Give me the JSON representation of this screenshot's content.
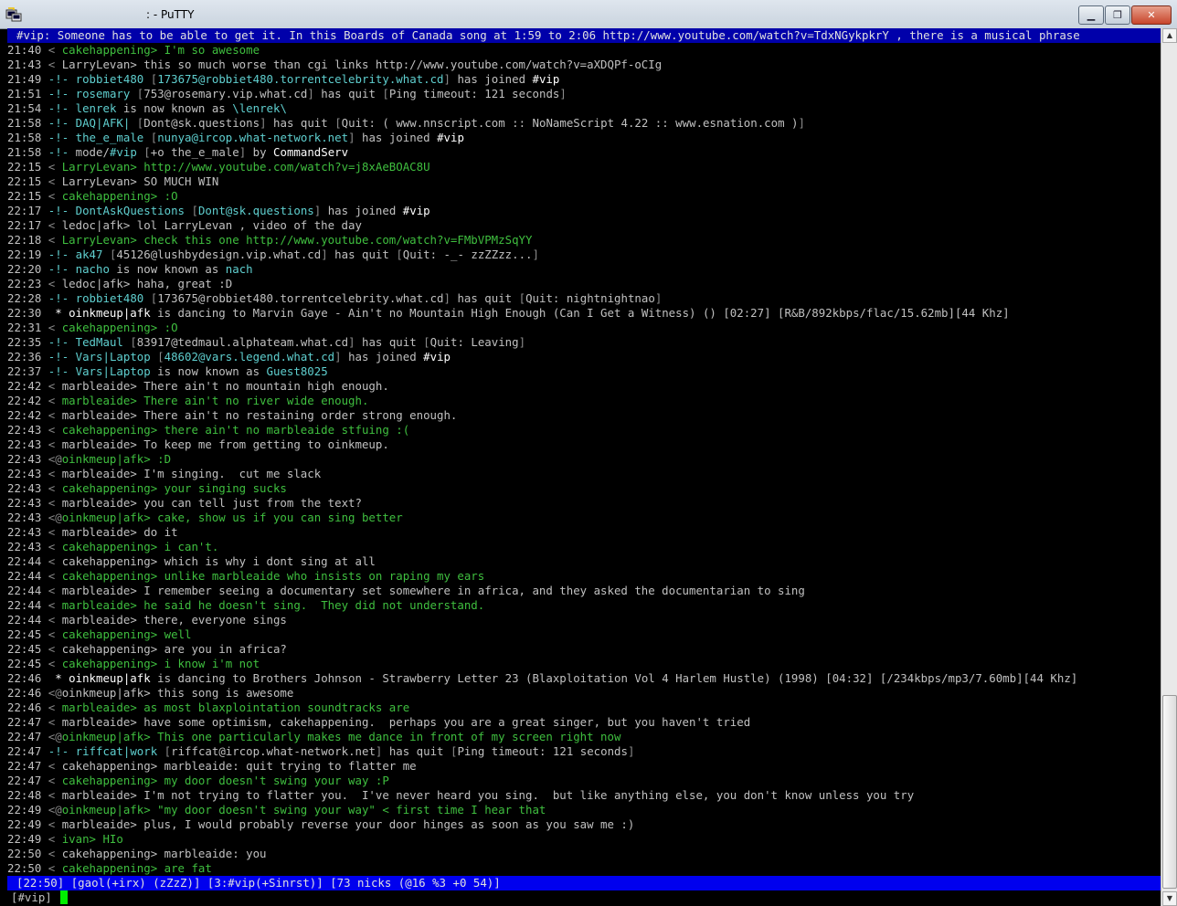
{
  "window": {
    "title": ": - PuTTY",
    "minimize_icon": "minimize-icon",
    "maximize_icon": "maximize-icon",
    "close_icon": "close-icon",
    "close_label": "✕",
    "minimize_label": "▁",
    "maximize_label": "❐"
  },
  "topic": "#vip: Someone has to be able to get it. In this Boards of Canada song at 1:59 to 2:06 http://www.youtube.com/watch?v=TdxNGykpkrY , there is a musical phrase",
  "lines": [
    {
      "time": "21:40",
      "kind": "msg",
      "nick": "cakehappening",
      "text": "I'm so awesome",
      "color": "g"
    },
    {
      "time": "21:43",
      "kind": "msg",
      "nick": "LarryLevan",
      "text": "this so much worse than cgi links http://www.youtube.com/watch?v=aXDQPf-oCIg",
      "color": "n"
    },
    {
      "time": "21:49",
      "kind": "join",
      "nick": "robbiet480",
      "host": "173675@robbiet480.torrentcelebrity.what.cd",
      "text": "has joined",
      "chan": "#vip"
    },
    {
      "time": "21:51",
      "kind": "quit",
      "nick": "rosemary",
      "host": "753@rosemary.vip.what.cd",
      "text": "has quit",
      "reason": "Ping timeout: 121 seconds"
    },
    {
      "time": "21:54",
      "kind": "nick",
      "nick": "lenrek",
      "text": "is now known as",
      "newnick": "\\lenrek\\"
    },
    {
      "time": "21:58",
      "kind": "quitraw",
      "nick": "DAQ|AFK|",
      "host": "Dont@sk.questions",
      "text": "has quit",
      "reason": "Quit: ( www.nnscript.com :: NoNameScript 4.22 :: www.esnation.com )"
    },
    {
      "time": "21:58",
      "kind": "join",
      "nick": "the_e_male",
      "host": "nunya@ircop.what-network.net",
      "text": "has joined",
      "chan": "#vip"
    },
    {
      "time": "21:58",
      "kind": "mode",
      "text": "mode/",
      "chan": "#vip",
      "modes": "+o the_e_male",
      "by": "by",
      "setter": "CommandServ"
    },
    {
      "time": "22:15",
      "kind": "msg",
      "nick": "LarryLevan",
      "text": "http://www.youtube.com/watch?v=j8xAeBOAC8U",
      "color": "g"
    },
    {
      "time": "22:15",
      "kind": "msg",
      "nick": "LarryLevan",
      "text": "SO MUCH WIN",
      "color": "n"
    },
    {
      "time": "22:15",
      "kind": "msg",
      "nick": "cakehappening",
      "text": ":O",
      "color": "g"
    },
    {
      "time": "22:17",
      "kind": "join",
      "nick": "DontAskQuestions",
      "host": "Dont@sk.questions",
      "text": "has joined",
      "chan": "#vip"
    },
    {
      "time": "22:17",
      "kind": "msg",
      "nick": "ledoc|afk",
      "text": "lol LarryLevan , video of the day",
      "color": "n"
    },
    {
      "time": "22:18",
      "kind": "msg",
      "nick": "LarryLevan",
      "text": "check this one http://www.youtube.com/watch?v=FMbVPMzSqYY",
      "color": "g"
    },
    {
      "time": "22:19",
      "kind": "quit",
      "nick": "ak47",
      "host": "45126@lushbydesign.vip.what.cd",
      "text": "has quit",
      "reason": "Quit: -_- zzZZzz..."
    },
    {
      "time": "22:20",
      "kind": "nick",
      "nick": "nacho",
      "text": "is now known as",
      "newnick": "nach"
    },
    {
      "time": "22:23",
      "kind": "msg",
      "nick": "ledoc|afk",
      "text": "haha, great :D",
      "color": "n"
    },
    {
      "time": "22:28",
      "kind": "quit",
      "nick": "robbiet480",
      "host": "173675@robbiet480.torrentcelebrity.what.cd",
      "text": "has quit",
      "reason": "Quit: nightnightnao"
    },
    {
      "time": "22:30",
      "kind": "action",
      "nick": "oinkmeup|afk",
      "text": "is dancing to Marvin Gaye - Ain't no Mountain High Enough (Can I Get a Witness) () [02:27] [R&B/892kbps/flac/15.62mb][44 Khz]"
    },
    {
      "time": "22:31",
      "kind": "msg",
      "nick": "cakehappening",
      "text": ":O",
      "color": "g"
    },
    {
      "time": "22:35",
      "kind": "quit",
      "nick": "TedMaul",
      "host": "83917@tedmaul.alphateam.what.cd",
      "text": "has quit",
      "reason": "Quit: Leaving"
    },
    {
      "time": "22:36",
      "kind": "join",
      "nick": "Vars|Laptop",
      "host": "48602@vars.legend.what.cd",
      "text": "has joined",
      "chan": "#vip"
    },
    {
      "time": "22:37",
      "kind": "nick",
      "nick": "Vars|Laptop",
      "text": "is now known as",
      "newnick": "Guest8025"
    },
    {
      "time": "22:42",
      "kind": "msg",
      "nick": "marbleaide",
      "text": "There ain't no mountain high enough.",
      "color": "n"
    },
    {
      "time": "22:42",
      "kind": "msg",
      "nick": "marbleaide",
      "text": "There ain't no river wide enough.",
      "color": "g"
    },
    {
      "time": "22:42",
      "kind": "msg",
      "nick": "marbleaide",
      "text": "There ain't no restaining order strong enough.",
      "color": "n"
    },
    {
      "time": "22:43",
      "kind": "msg",
      "nick": "cakehappening",
      "text": "there ain't no marbleaide stfuing :(",
      "color": "g"
    },
    {
      "time": "22:43",
      "kind": "msg",
      "nick": "marbleaide",
      "text": "To keep me from getting to oinkmeup.",
      "color": "n"
    },
    {
      "time": "22:43",
      "kind": "opmsg",
      "nick": "oinkmeup|afk",
      "text": ":D",
      "color": "g"
    },
    {
      "time": "22:43",
      "kind": "msg",
      "nick": "marbleaide",
      "text": "I'm singing.  cut me slack",
      "color": "n"
    },
    {
      "time": "22:43",
      "kind": "msg",
      "nick": "cakehappening",
      "text": "your singing sucks",
      "color": "g"
    },
    {
      "time": "22:43",
      "kind": "msg",
      "nick": "marbleaide",
      "text": "you can tell just from the text?",
      "color": "n"
    },
    {
      "time": "22:43",
      "kind": "opmsg",
      "nick": "oinkmeup|afk",
      "text": "cake, show us if you can sing better",
      "color": "g"
    },
    {
      "time": "22:43",
      "kind": "msg",
      "nick": "marbleaide",
      "text": "do it",
      "color": "n"
    },
    {
      "time": "22:43",
      "kind": "msg",
      "nick": "cakehappening",
      "text": "i can't.",
      "color": "g"
    },
    {
      "time": "22:44",
      "kind": "msg",
      "nick": "cakehappening",
      "text": "which is why i dont sing at all",
      "color": "n"
    },
    {
      "time": "22:44",
      "kind": "msg",
      "nick": "cakehappening",
      "text": "unlike marbleaide who insists on raping my ears",
      "color": "g"
    },
    {
      "time": "22:44",
      "kind": "msg",
      "nick": "marbleaide",
      "text": "I remember seeing a documentary set somewhere in africa, and they asked the documentarian to sing",
      "color": "n"
    },
    {
      "time": "22:44",
      "kind": "msg",
      "nick": "marbleaide",
      "text": "he said he doesn't sing.  They did not understand.",
      "color": "g"
    },
    {
      "time": "22:44",
      "kind": "msg",
      "nick": "marbleaide",
      "text": "there, everyone sings",
      "color": "n"
    },
    {
      "time": "22:45",
      "kind": "msg",
      "nick": "cakehappening",
      "text": "well",
      "color": "g"
    },
    {
      "time": "22:45",
      "kind": "msg",
      "nick": "cakehappening",
      "text": "are you in africa?",
      "color": "n"
    },
    {
      "time": "22:45",
      "kind": "msg",
      "nick": "cakehappening",
      "text": "i know i'm not",
      "color": "g"
    },
    {
      "time": "22:46",
      "kind": "action",
      "nick": "oinkmeup|afk",
      "text": "is dancing to Brothers Johnson - Strawberry Letter 23 (Blaxploitation Vol 4 Harlem Hustle) (1998) [04:32] [/234kbps/mp3/7.60mb][44 Khz]"
    },
    {
      "time": "22:46",
      "kind": "opmsg",
      "nick": "oinkmeup|afk",
      "text": "this song is awesome",
      "color": "n"
    },
    {
      "time": "22:46",
      "kind": "msg",
      "nick": "marbleaide",
      "text": "as most blaxplointation soundtracks are",
      "color": "g"
    },
    {
      "time": "22:47",
      "kind": "msg",
      "nick": "marbleaide",
      "text": "have some optimism, cakehappening.  perhaps you are a great singer, but you haven't tried",
      "color": "n"
    },
    {
      "time": "22:47",
      "kind": "opmsg",
      "nick": "oinkmeup|afk",
      "text": "This one particularly makes me dance in front of my screen right now",
      "color": "g"
    },
    {
      "time": "22:47",
      "kind": "quit",
      "nick": "riffcat|work",
      "host": "riffcat@ircop.what-network.net",
      "text": "has quit",
      "reason": "Ping timeout: 121 seconds"
    },
    {
      "time": "22:47",
      "kind": "msg",
      "nick": "cakehappening",
      "text": "marbleaide: quit trying to flatter me",
      "color": "n"
    },
    {
      "time": "22:47",
      "kind": "msg",
      "nick": "cakehappening",
      "text": "my door doesn't swing your way :P",
      "color": "g"
    },
    {
      "time": "22:48",
      "kind": "msg",
      "nick": "marbleaide",
      "text": "I'm not trying to flatter you.  I've never heard you sing.  but like anything else, you don't know unless you try",
      "color": "n"
    },
    {
      "time": "22:49",
      "kind": "opmsg",
      "nick": "oinkmeup|afk",
      "text": "\"my door doesn't swing your way\" < first time I hear that",
      "color": "g"
    },
    {
      "time": "22:49",
      "kind": "msg",
      "nick": "marbleaide",
      "text": "plus, I would probably reverse your door hinges as soon as you saw me :)",
      "color": "n"
    },
    {
      "time": "22:49",
      "kind": "msg",
      "nick": "ivan",
      "text": "HIo",
      "color": "g"
    },
    {
      "time": "22:50",
      "kind": "msg",
      "nick": "cakehappening",
      "text": "marbleaide: you",
      "color": "n"
    },
    {
      "time": "22:50",
      "kind": "msg",
      "nick": "cakehappening",
      "text": "are fat",
      "color": "g"
    }
  ],
  "statusbar": {
    "time": "[22:50]",
    "user": "[gaol(+irx)",
    "away": "(zZzZ)]",
    "window": "[3:#vip(+Sinrst)]",
    "nicks": "[73 nicks (@16 %3 +0 54)]"
  },
  "input": {
    "prompt": "[#vip]",
    "value": ""
  },
  "scrollbar": {
    "position": 0.85
  }
}
